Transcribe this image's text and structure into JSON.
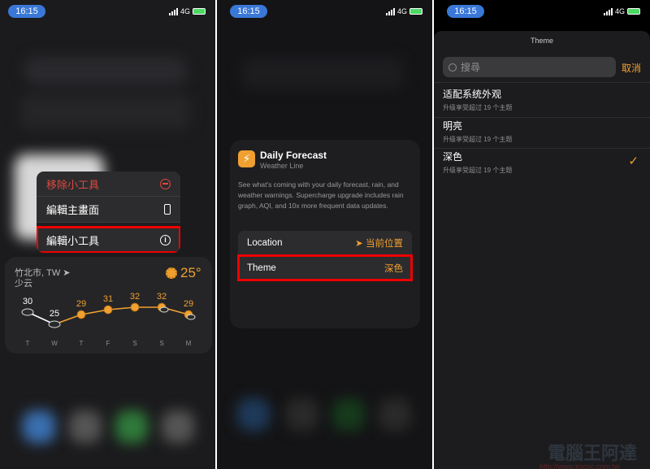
{
  "status_bar": {
    "time": "16:15",
    "network": "4G"
  },
  "panel1": {
    "context_menu": [
      {
        "label": "移除小工具",
        "icon": "minus-circle-icon",
        "destructive": true
      },
      {
        "label": "編輯主畫面",
        "icon": "phone-icon"
      },
      {
        "label": "編輯小工具",
        "icon": "info-circle-icon",
        "highlighted": true
      }
    ],
    "widget": {
      "location": "竹北市, TW",
      "condition": "少云",
      "current_temp": "25°",
      "days": [
        {
          "day": "T",
          "temp": "30",
          "icon": "cloud-icon"
        },
        {
          "day": "W",
          "temp": "25",
          "icon": "cloud-icon"
        },
        {
          "day": "T",
          "temp": "29",
          "icon": "sun-icon"
        },
        {
          "day": "F",
          "temp": "31",
          "icon": "sun-icon"
        },
        {
          "day": "S",
          "temp": "32",
          "icon": "sun-icon"
        },
        {
          "day": "S",
          "temp": "32",
          "icon": "sun-cloud-icon"
        },
        {
          "day": "M",
          "temp": "29",
          "icon": "sun-cloud-icon"
        }
      ]
    }
  },
  "panel2": {
    "title": "Daily Forecast",
    "subtitle": "Weather Line",
    "description": "See what's coming with your daily forecast, rain, and weather warnings. Supercharge upgrade includes rain graph, AQI, and 10x more frequent data updates.",
    "location_label": "Location",
    "location_value": "当前位置",
    "theme_label": "Theme",
    "theme_value": "深色"
  },
  "panel3": {
    "title": "Theme",
    "search_placeholder": "搜尋",
    "cancel": "取消",
    "options": [
      {
        "label": "适配系统外观",
        "sub": "升级享受超过 19 个主题",
        "selected": false
      },
      {
        "label": "明亮",
        "sub": "升级享受超过 19 个主题",
        "selected": false
      },
      {
        "label": "深色",
        "sub": "升级享受超过 19 个主题",
        "selected": true
      }
    ]
  },
  "watermark": {
    "text": "電腦王阿達",
    "url": "http://www.kocpc.com.tw"
  },
  "colors": {
    "accent": "#f0a030",
    "destructive": "#e0483e",
    "highlight_box": "#ee0000"
  }
}
